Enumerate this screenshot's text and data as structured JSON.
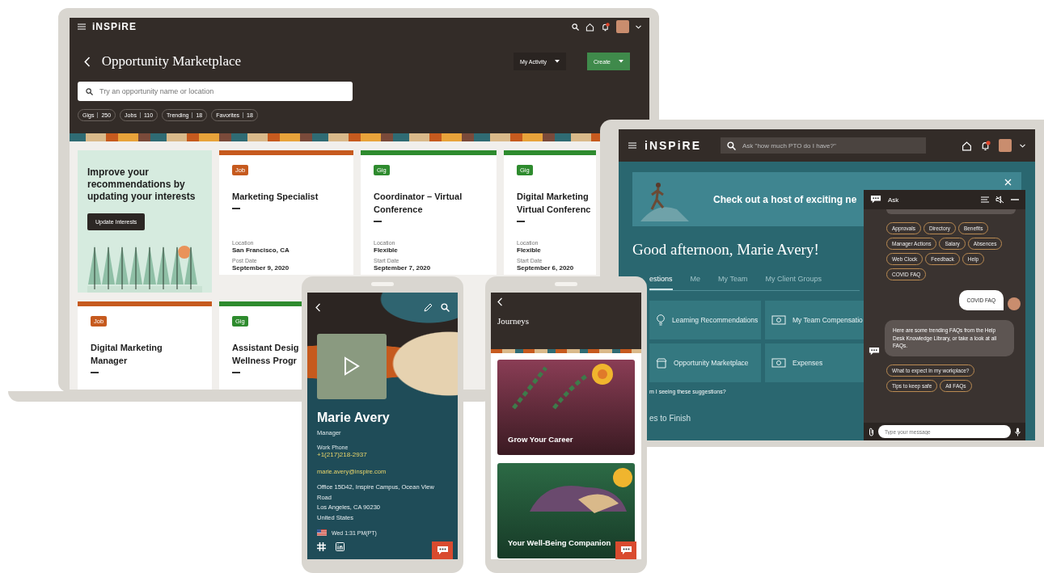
{
  "laptop": {
    "logo": "iNSPiRE",
    "page_title": "Opportunity Marketplace",
    "actions": [
      {
        "label": "My Activity",
        "kind": "menu"
      },
      {
        "label": "Create",
        "kind": "primary"
      }
    ],
    "search": {
      "placeholder": "Try an opportunity name or location"
    },
    "filters": [
      {
        "label": "Gigs",
        "count": "250"
      },
      {
        "label": "Jobs",
        "count": "110"
      },
      {
        "label": "Trending",
        "count": "18"
      },
      {
        "label": "Favorites",
        "count": "18"
      }
    ],
    "promo": {
      "text": "Improve your recommendations by updating your interests",
      "button": "Update Interests"
    },
    "cards": [
      {
        "tag": "Job",
        "color": "#c65a1e",
        "title_lines": [
          "Marketing Specialist"
        ],
        "fields": [
          {
            "label": "Location",
            "value": "San Francisco, CA"
          },
          {
            "label": "Post Date",
            "value": "September 9, 2020"
          }
        ]
      },
      {
        "tag": "Gig",
        "color": "#2e8b2e",
        "title_lines": [
          "Coordinator – Virtual",
          "Conference"
        ],
        "fields": [
          {
            "label": "Location",
            "value": "Flexible"
          },
          {
            "label": "Start Date",
            "value": "September 7, 2020"
          }
        ]
      },
      {
        "tag": "Gig",
        "color": "#2e8b2e",
        "title_lines": [
          "Digital Marketing",
          "Virtual Conferenc"
        ],
        "fields": [
          {
            "label": "Location",
            "value": "Flexible"
          },
          {
            "label": "Start Date",
            "value": "September 6, 2020"
          }
        ]
      },
      {
        "tag": "Job",
        "color": "#c65a1e",
        "title_lines": [
          "Digital Marketing",
          "Manager"
        ]
      },
      {
        "tag": "Gig",
        "color": "#2e8b2e",
        "title_lines": [
          "Assistant Desig",
          "Wellness Progr"
        ]
      }
    ]
  },
  "tablet": {
    "logo": "iNSPiRE",
    "search": {
      "placeholder": "Ask \"how much PTO do I have?\""
    },
    "banner": "Check out a host of exciting ne",
    "greeting": "Good afternoon, Marie Avery!",
    "tabs": [
      {
        "label": "estions",
        "selected": true
      },
      {
        "label": "Me",
        "selected": false
      },
      {
        "label": "My Team",
        "selected": false
      },
      {
        "label": "My Client Groups",
        "selected": false
      }
    ],
    "tiles": [
      {
        "label": "Learning Recommendations",
        "kind": "learning"
      },
      {
        "label": "My Team Compensatio",
        "kind": "money"
      },
      {
        "label": "Opportunity Marketplace",
        "kind": "store"
      },
      {
        "label": "Expenses",
        "kind": "money"
      }
    ],
    "suggestion_link": "m I seeing these suggestions?",
    "section_title": "es to Finish",
    "chat": {
      "title": "Ask",
      "chips": [
        "Approvals",
        "Directory",
        "Benefits",
        "Manager Actions",
        "Salary",
        "Absences",
        "Web Clock",
        "Feedback",
        "Help",
        "COVID FAQ"
      ],
      "user_message": "COVID FAQ",
      "bot_message": "Here are some trending FAQs from the Help Desk Knowledge Library, or take a look at all FAQs.",
      "reply_chips": [
        "What to expect in my workplace?",
        "Tips to keep safe",
        "All FAQs"
      ],
      "input": {
        "placeholder": "Type your message"
      }
    }
  },
  "profile_phone": {
    "name": "Marie Avery",
    "role": "Manager",
    "phone_label": "Work Phone",
    "phone": "+1(217)218-2937",
    "email": "marie.avery@inspire.com",
    "address_lines": [
      "Office 15D42, Inspire Campus, Ocean View Road",
      "Los Angeles, CA 90230",
      "United States"
    ],
    "local_time": "Wed 1:31 PM(PT)"
  },
  "journeys_phone": {
    "title": "Journeys",
    "journeys": [
      {
        "title": "Grow Your Career",
        "kind": "career"
      },
      {
        "title": "Your Well-Being Companion",
        "kind": "wellbeing"
      }
    ]
  }
}
